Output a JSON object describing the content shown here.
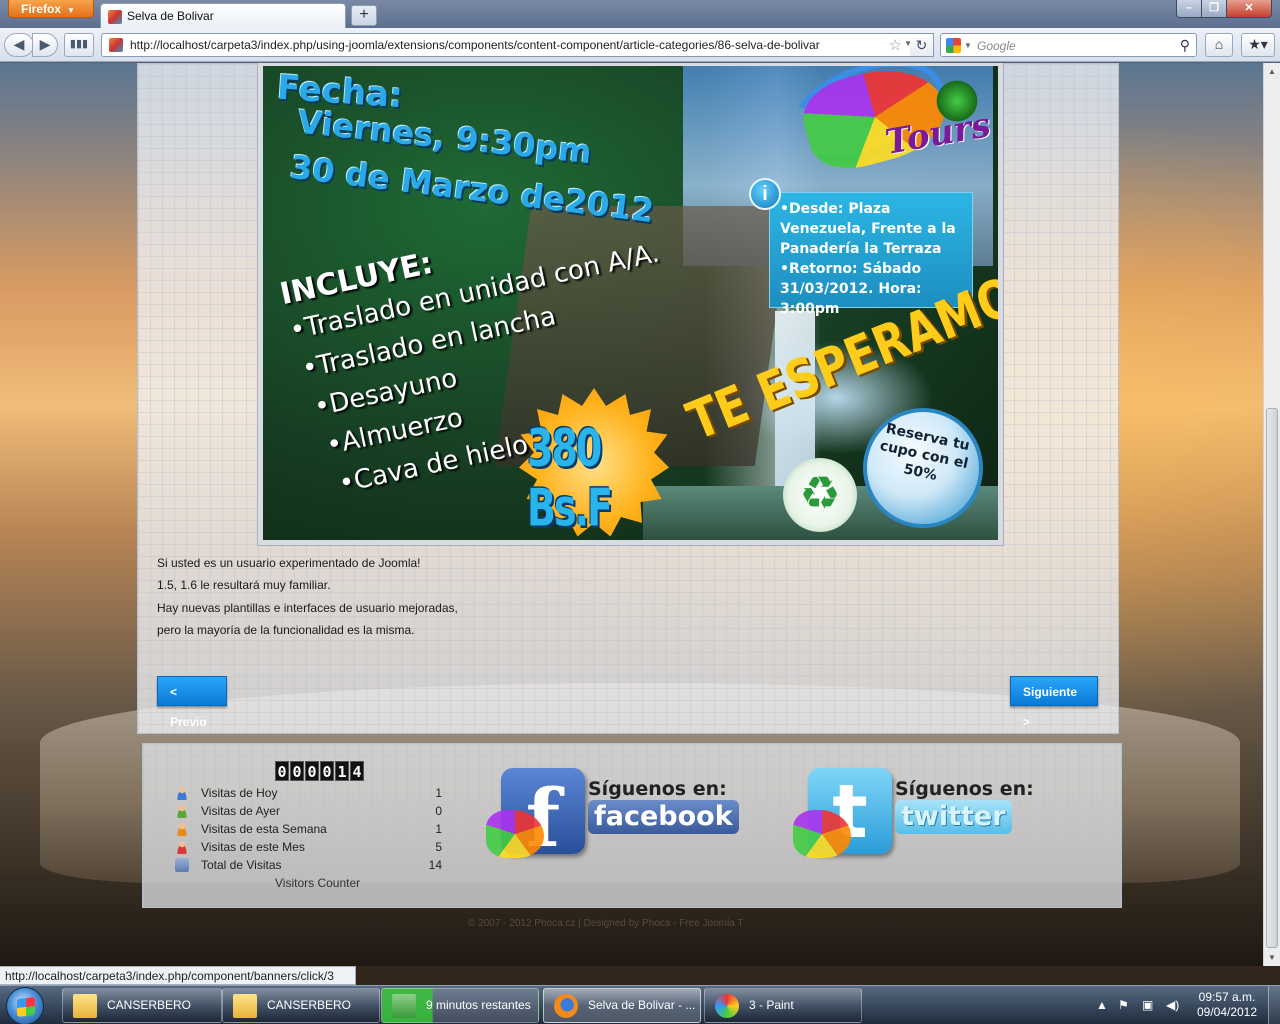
{
  "browser": {
    "menu_label": "Firefox",
    "tab_title": "Selva de Bolivar",
    "new_tab": "+",
    "url": "http://localhost/carpeta3/index.php/using-joomla/extensions/components/content-component/article-categories/86-selva-de-bolivar",
    "search_placeholder": "Google",
    "status_url": "http://localhost/carpeta3/index.php/component/banners/click/3"
  },
  "poster": {
    "fecha_label": "Fecha:",
    "fecha_day": "Viernes, 9:30pm",
    "fecha_date": "30 de Marzo de2012",
    "incluye_title": "INCLUYE:",
    "incluye_items": [
      "•Traslado en unidad con A/A.",
      "•Traslado en lancha",
      "•Desayuno",
      "•Almuerzo",
      "•Cava de hielo"
    ],
    "info_line1": "•Desde: Plaza Venezuela, Frente a la Panadería  la Terraza",
    "info_line2": "•Retorno: Sábado 31/03/2012. Hora: 3:00pm",
    "price": "380 Bs.F",
    "te_esperamos": "TE ESPERAMOS",
    "reserva": "Reserva tu cupo con el 50%",
    "logo_text": "Tours"
  },
  "article": {
    "lines": [
      "Si usted es un usuario experimentado de Joomla!",
      "1.5, 1.6 le resultará muy familiar.",
      "Hay nuevas plantillas e interfaces de usuario mejoradas,",
      "pero la mayoría de la funcionalidad es la misma."
    ],
    "prev_label": "< Previo",
    "next_label": "Siguiente >"
  },
  "counter": {
    "digits": [
      "0",
      "0",
      "0",
      "0",
      "1",
      "4"
    ],
    "rows": [
      {
        "label": "Visitas de Hoy",
        "value": "1",
        "color": "#3a7ad8"
      },
      {
        "label": "Visitas de Ayer",
        "value": "0",
        "color": "#5aa83a"
      },
      {
        "label": "Visitas de esta Semana",
        "value": "1",
        "color": "#e88a1a"
      },
      {
        "label": "Visitas de este Mes",
        "value": "5",
        "color": "#d83a3a"
      },
      {
        "label": "Total de Visitas",
        "value": "14",
        "color": "#5a7ab0"
      }
    ],
    "caption": "Visitors Counter"
  },
  "social": {
    "follow_label": "Síguenos en:",
    "facebook": "facebook",
    "twitter": "twitter"
  },
  "footer": {
    "copyright": "© 2007 - 2012 Phoca.cz | Designed by Phoca - Free Joomla T"
  },
  "taskbar": {
    "items": [
      {
        "label": "CANSERBERO"
      },
      {
        "label": "CANSERBERO"
      },
      {
        "label": "9 minutos restantes"
      },
      {
        "label": "Selva de Bolivar - ..."
      },
      {
        "label": "3 - Paint"
      }
    ],
    "time": "09:57 a.m.",
    "date": "09/04/2012"
  }
}
